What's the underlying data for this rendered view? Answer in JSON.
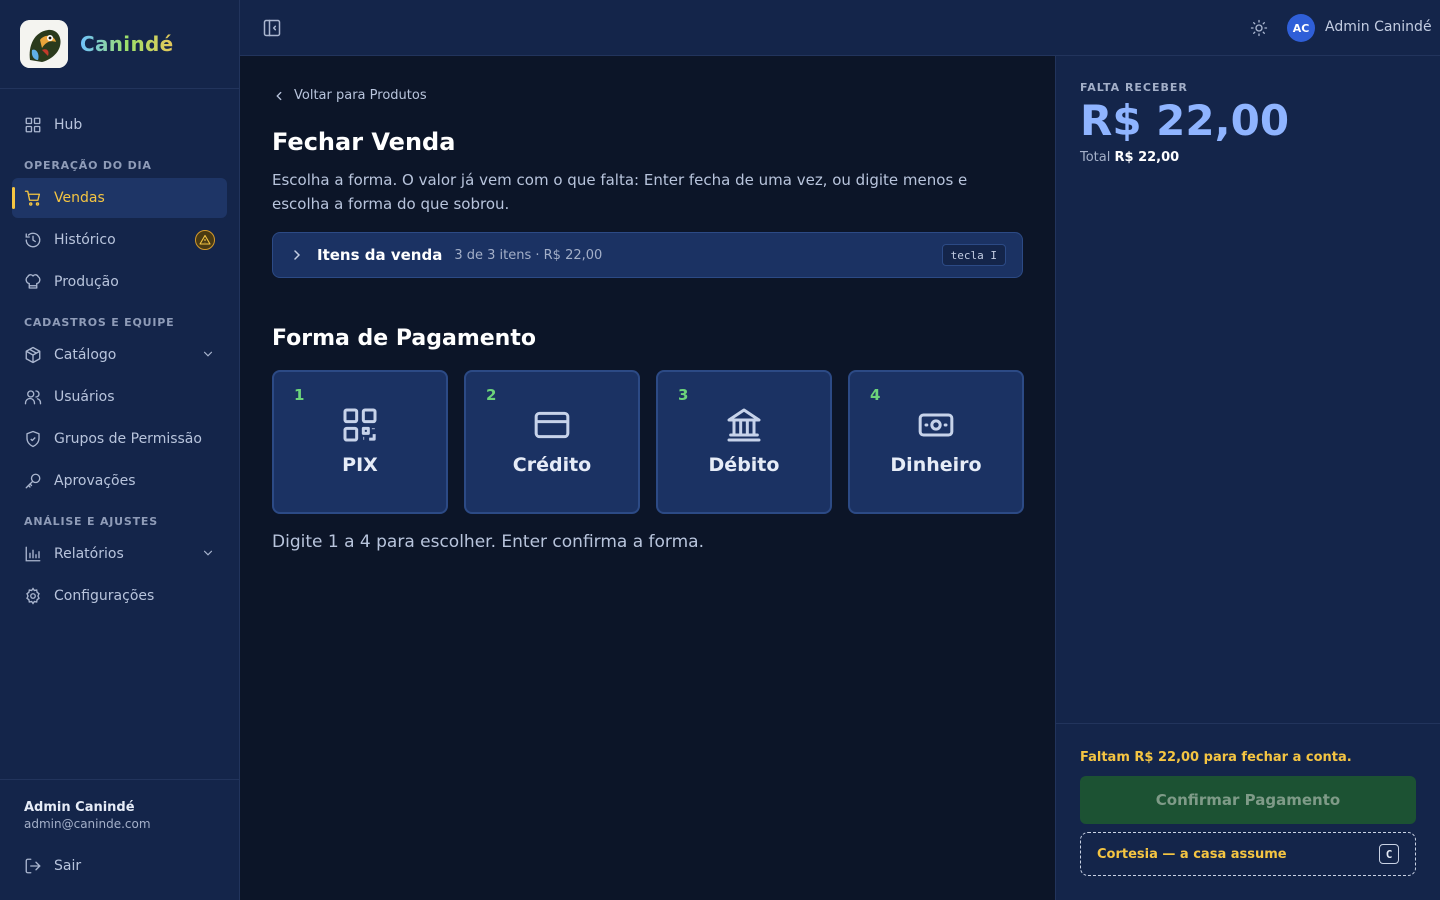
{
  "brand": {
    "name": "Canindé"
  },
  "sidebar": {
    "items_top": [
      {
        "label": "Hub",
        "icon": "grid-icon"
      }
    ],
    "sections": [
      {
        "label": "OPERAÇÃO DO DIA",
        "items": [
          {
            "label": "Vendas",
            "icon": "cart-icon",
            "active": true
          },
          {
            "label": "Histórico",
            "icon": "history-icon",
            "badge": "warning-icon"
          },
          {
            "label": "Produção",
            "icon": "chef-hat-icon"
          }
        ]
      },
      {
        "label": "CADASTROS E EQUIPE",
        "items": [
          {
            "label": "Catálogo",
            "icon": "package-icon",
            "expandable": true
          },
          {
            "label": "Usuários",
            "icon": "users-icon"
          },
          {
            "label": "Grupos de Permissão",
            "icon": "shield-icon"
          },
          {
            "label": "Aprovações",
            "icon": "key-icon"
          }
        ]
      },
      {
        "label": "ANÁLISE E AJUSTES",
        "items": [
          {
            "label": "Relatórios",
            "icon": "bar-chart-icon",
            "expandable": true
          },
          {
            "label": "Configurações",
            "icon": "gear-icon"
          }
        ]
      }
    ],
    "footer": {
      "name": "Admin Canindé",
      "email": "admin@caninde.com",
      "logout": "Sair"
    }
  },
  "topbar": {
    "avatar_initials": "AC",
    "user_name": "Admin Canindé"
  },
  "main": {
    "back_link": "Voltar para Produtos",
    "title": "Fechar Venda",
    "description": "Escolha a forma. O valor já vem com o que falta: Enter fecha de uma vez, ou digite menos e escolha a forma do que sobrou.",
    "items_bar": {
      "title": "Itens da venda",
      "meta": "3 de 3 itens · R$ 22,00",
      "key_hint": "tecla I"
    },
    "payment_title": "Forma de Pagamento",
    "methods": [
      {
        "key": "1",
        "label": "PIX",
        "icon": "qr-code-icon"
      },
      {
        "key": "2",
        "label": "Crédito",
        "icon": "credit-card-icon"
      },
      {
        "key": "3",
        "label": "Débito",
        "icon": "bank-icon"
      },
      {
        "key": "4",
        "label": "Dinheiro",
        "icon": "banknote-icon"
      }
    ],
    "hint": "Digite 1 a 4 para escolher. Enter confirma a forma."
  },
  "summary": {
    "falta_label": "FALTA RECEBER",
    "falta_value": "R$ 22,00",
    "total_label": "Total",
    "total_value": "R$ 22,00",
    "faltam_text": "Faltam R$ 22,00 para fechar a conta.",
    "confirm_label": "Confirmar Pagamento",
    "cortesia_label": "Cortesia — a casa assume",
    "cortesia_key": "C"
  },
  "colors": {
    "accent": "#f5c542",
    "primary": "#8fb4ff",
    "success_key": "#6cd47a",
    "bg": "#0c1528",
    "panel": "#14254a"
  }
}
